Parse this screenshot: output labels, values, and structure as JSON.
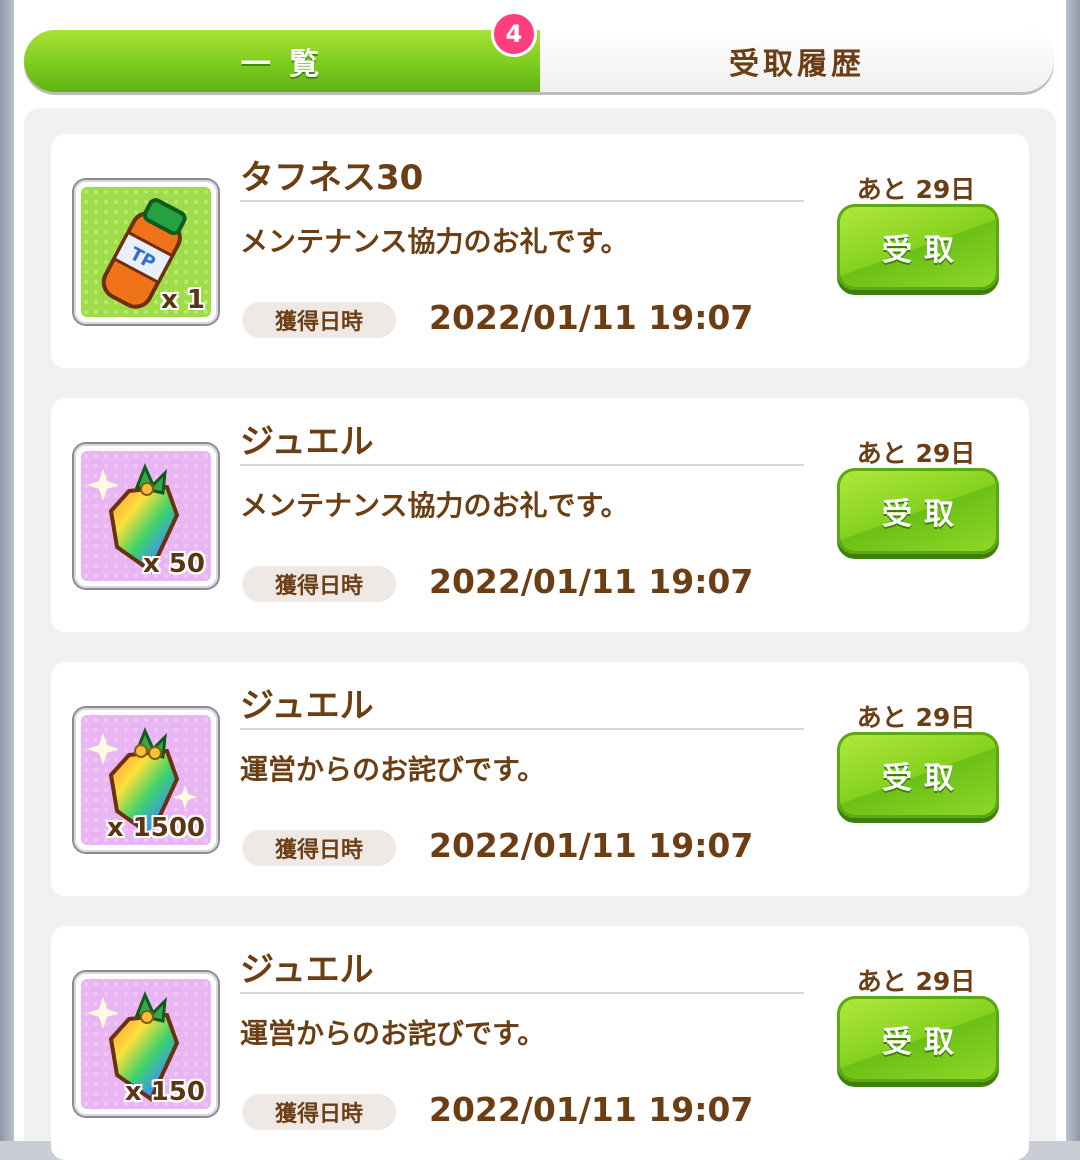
{
  "tabs": {
    "list_label": "一 覧",
    "history_label": "受取履歴",
    "badge_count": "4",
    "active_tab": "list"
  },
  "colors": {
    "accent_green": "#7dcc1d",
    "text_brown": "#6b3e14",
    "badge_pink": "#ff3d7f"
  },
  "items": [
    {
      "name": "タフネス30",
      "quantity": "x 1",
      "icon": "tp-bottle-icon",
      "description": "メンテナンス協力のお礼です。",
      "date_label": "獲得日時",
      "date": "2022/01/11 19:07",
      "remaining": "あと 29日",
      "claim_label": "受取"
    },
    {
      "name": "ジュエル",
      "quantity": "x 50",
      "icon": "jewel-icon",
      "description": "メンテナンス協力のお礼です。",
      "date_label": "獲得日時",
      "date": "2022/01/11 19:07",
      "remaining": "あと 29日",
      "claim_label": "受取"
    },
    {
      "name": "ジュエル",
      "quantity": "x 1500",
      "icon": "jewel-icon",
      "description": "運営からのお詫びです。",
      "date_label": "獲得日時",
      "date": "2022/01/11 19:07",
      "remaining": "あと 29日",
      "claim_label": "受取"
    },
    {
      "name": "ジュエル",
      "quantity": "x 150",
      "icon": "jewel-icon",
      "description": "運営からのお詫びです。",
      "date_label": "獲得日時",
      "date": "2022/01/11 19:07",
      "remaining": "あと 29日",
      "claim_label": "受取"
    }
  ]
}
